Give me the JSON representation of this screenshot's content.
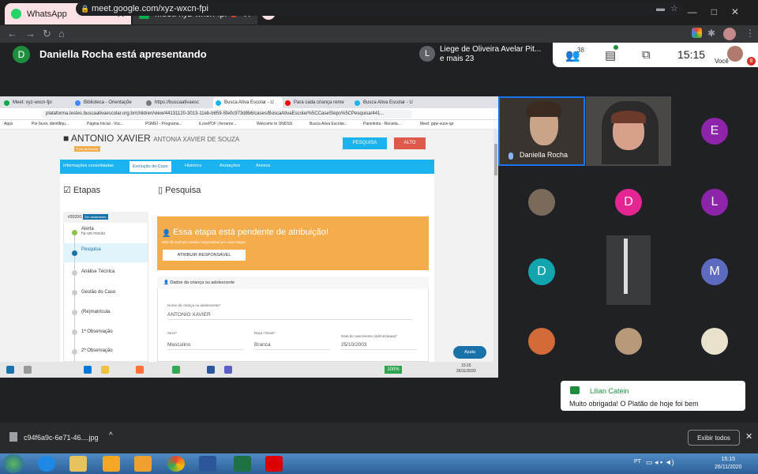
{
  "browser": {
    "tabs": [
      {
        "title": "WhatsApp",
        "color": "#25d366"
      },
      {
        "title": "Meet: xyz-wxcn-fpi",
        "color": "#00ac47"
      }
    ],
    "url": "meet.google.com/xyz-wxcn-fpi"
  },
  "meet": {
    "presenter_initial": "D",
    "presenting_text": "Daniella Rocha está apresentando",
    "notif_initial": "L",
    "notif_line1": "Liege de Oliveira Avelar Pit...",
    "notif_line2": "e mais 23",
    "participant_count": "38",
    "clock": "15:15",
    "self_label": "Você",
    "self_badge": "8",
    "presenter_tile_label": "Daniella Rocha",
    "participants": [
      {
        "initial": "E",
        "color": "#8e24aa"
      },
      {
        "initial": "D",
        "color": "#e52592"
      },
      {
        "initial": "L",
        "color": "#8e24aa"
      },
      {
        "initial": "D",
        "color": "#12a4af"
      },
      {
        "initial": "M",
        "color": "#5c6bc0"
      }
    ]
  },
  "inner": {
    "tabs": [
      "Meet: xyz-wxcn-fpi",
      "Biblioteca - Orientaçõe",
      "https://buscaativaesc",
      "Busca Ativa Escolar - U",
      "Para cada criança reme",
      "Busca Ativa Escolar - U"
    ],
    "url": "plataforma.testes.buscaativaescolar.org.br/children/view/44131120-3013-11eb-b659-5fe0c973d8b6/cases/BuscaAtivaEscolar%5CCaseSteps%5CPesquisa/441...",
    "bookmarks": [
      "Apps",
      "Por favor, identifiqu...",
      "Página Inicial - Voc...",
      "PGMEI - Programa...",
      "iLovePDF | ferrame...",
      "Welcome to UNDSS",
      "Busca Ativa Escolar...",
      "Panelinha - Receita...",
      "Meet: gqw-vunv-igr"
    ],
    "student_name": "ANTONIO XAVIER",
    "student_subname": "ANTONIA XAVIER DE SOUZA",
    "fora_badge": "Fora da Escola",
    "btn_pesquisa": "PESQUISA",
    "btn_alto": "ALTO",
    "nav": [
      "Informações consolidadas",
      "Evolução do Caso",
      "Histórico",
      "Anotações",
      "Anexos"
    ],
    "etapas_title": "Etapas",
    "pesquisa_title": "Pesquisa",
    "steps_year": "#2020/1",
    "steps_status": "Em andamento",
    "steps": [
      {
        "label": "Alerta",
        "sub": "há um minuto"
      },
      {
        "label": "Pesquisa",
        "sub": ""
      },
      {
        "label": "Análise Técnica",
        "sub": ""
      },
      {
        "label": "Gestão do Caso",
        "sub": ""
      },
      {
        "label": "(Re)matrícula",
        "sub": ""
      },
      {
        "label": "1ª Observação",
        "sub": ""
      },
      {
        "label": "2ª Observação",
        "sub": ""
      }
    ],
    "pending_title": "Essa etapa está pendente de atribuição!",
    "pending_sub": "Não há nenhum usuário responsável por essa etapa!",
    "btn_atribuir": "ATRIBUIR RESPONSÁVEL",
    "dados_title": "Dados da criança ou adolescente",
    "field_name_label": "Nome da criança ou adolescente*",
    "field_name_value": "ANTONIO XAVIER",
    "field_sexo_label": "Sexo*",
    "field_sexo_value": "Masculino",
    "field_raca_label": "Raça / Etnia*",
    "field_raca_value": "Branca",
    "field_nasc_label": "Data de nascimento (dd/mm/aaaa)*",
    "field_nasc_value": "25/10/2003",
    "ajuda": "Ajuda",
    "zoom": "100%",
    "time": "15:15",
    "date": "26/11/2020"
  },
  "toast": {
    "name": "Lilian Catein",
    "message": "Muito obrigada! O Platão de hoje  foi bem"
  },
  "download": {
    "filename": "c94f6a9c-6e71-46....jpg",
    "show_all": "Exibir todos"
  },
  "windows": {
    "lang": "PT",
    "time": "15:15",
    "date": "26/11/2020"
  }
}
